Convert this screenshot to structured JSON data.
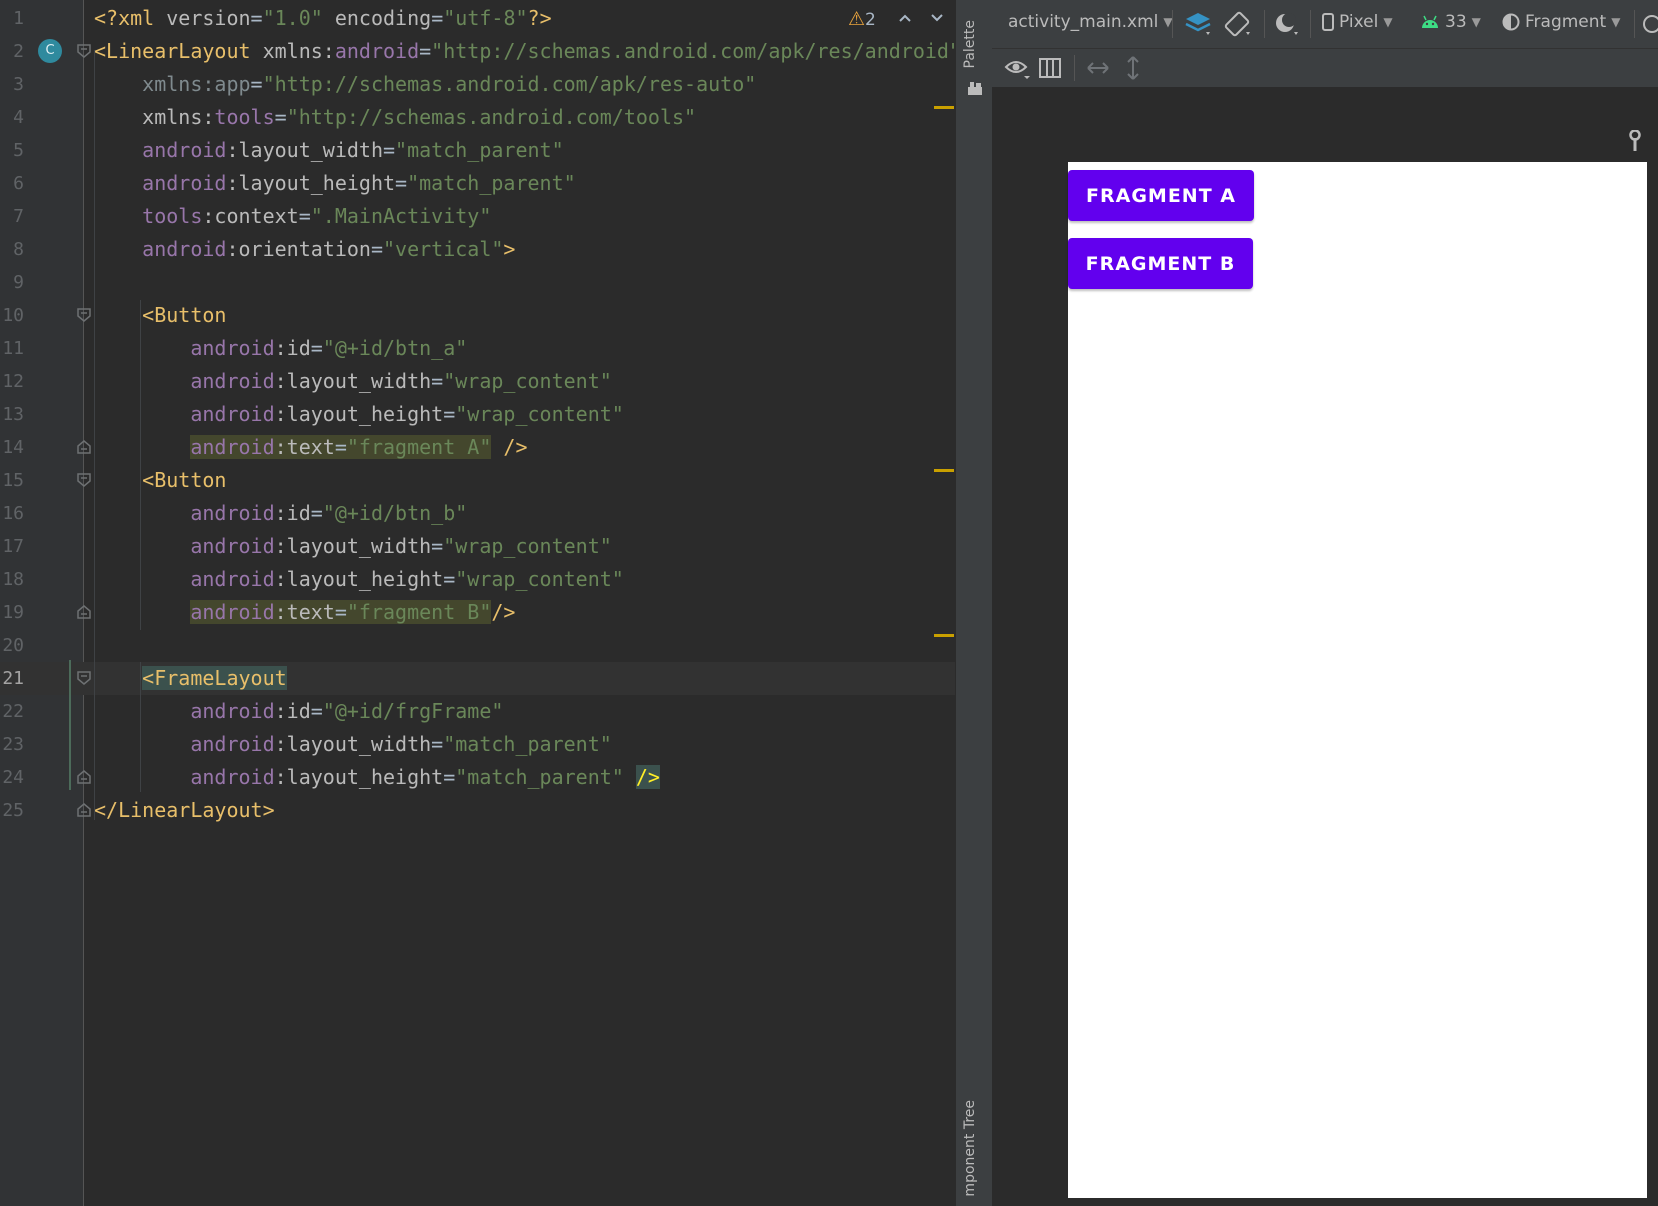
{
  "editor": {
    "warning_count": "2",
    "lines": [
      {
        "n": "1",
        "segs": [
          [
            "tag",
            "<?xml "
          ],
          [
            "attr",
            "version"
          ],
          [
            "eq",
            "="
          ],
          [
            "val",
            "\"1.0\""
          ],
          [
            "attr",
            " encoding"
          ],
          [
            "eq",
            "="
          ],
          [
            "val",
            "\"utf-8\""
          ],
          [
            "tag",
            "?>"
          ]
        ]
      },
      {
        "n": "2",
        "segs": [
          [
            "tag",
            "<LinearLayout "
          ],
          [
            "attr",
            "xmlns:"
          ],
          [
            "ns",
            "android"
          ],
          [
            "eq",
            "="
          ],
          [
            "val",
            "\"http://schemas.android.com/apk/res/android\""
          ]
        ]
      },
      {
        "n": "3",
        "segs": [
          [
            "dim",
            "    xmlns:app"
          ],
          [
            "eq",
            "="
          ],
          [
            "val",
            "\"http://schemas.android.com/apk/res-auto\""
          ]
        ]
      },
      {
        "n": "4",
        "segs": [
          [
            "attr",
            "    xmlns:"
          ],
          [
            "ns",
            "tools"
          ],
          [
            "eq",
            "="
          ],
          [
            "val",
            "\"http://schemas.android.com/tools\""
          ]
        ]
      },
      {
        "n": "5",
        "segs": [
          [
            "ns",
            "    android"
          ],
          [
            "attr",
            ":layout_width"
          ],
          [
            "eq",
            "="
          ],
          [
            "val",
            "\"match_parent\""
          ]
        ]
      },
      {
        "n": "6",
        "segs": [
          [
            "ns",
            "    android"
          ],
          [
            "attr",
            ":layout_height"
          ],
          [
            "eq",
            "="
          ],
          [
            "val",
            "\"match_parent\""
          ]
        ]
      },
      {
        "n": "7",
        "segs": [
          [
            "ns",
            "    tools"
          ],
          [
            "attr",
            ":context"
          ],
          [
            "eq",
            "="
          ],
          [
            "val",
            "\".MainActivity\""
          ]
        ]
      },
      {
        "n": "8",
        "segs": [
          [
            "ns",
            "    android"
          ],
          [
            "attr",
            ":orientation"
          ],
          [
            "eq",
            "="
          ],
          [
            "val",
            "\"vertical\""
          ],
          [
            "tag",
            ">"
          ]
        ]
      },
      {
        "n": "9",
        "segs": []
      },
      {
        "n": "10",
        "segs": [
          [
            "tag",
            "    <Button"
          ]
        ]
      },
      {
        "n": "11",
        "segs": [
          [
            "ns",
            "        android"
          ],
          [
            "attr",
            ":id"
          ],
          [
            "eq",
            "="
          ],
          [
            "val",
            "\"@+id/btn_a\""
          ]
        ]
      },
      {
        "n": "12",
        "segs": [
          [
            "ns",
            "        android"
          ],
          [
            "attr",
            ":layout_width"
          ],
          [
            "eq",
            "="
          ],
          [
            "val",
            "\"wrap_content\""
          ]
        ]
      },
      {
        "n": "13",
        "segs": [
          [
            "ns",
            "        android"
          ],
          [
            "attr",
            ":layout_height"
          ],
          [
            "eq",
            "="
          ],
          [
            "val",
            "\"wrap_content\""
          ]
        ]
      },
      {
        "n": "14",
        "segs": [
          [
            "attr",
            "        "
          ],
          [
            "nshl",
            "android"
          ],
          [
            "attrhl",
            ":text"
          ],
          [
            "eqhl",
            "="
          ],
          [
            "valhl",
            "\"fragment A\""
          ],
          [
            "tag",
            " />"
          ]
        ]
      },
      {
        "n": "15",
        "segs": [
          [
            "tag",
            "    <Button"
          ]
        ]
      },
      {
        "n": "16",
        "segs": [
          [
            "ns",
            "        android"
          ],
          [
            "attr",
            ":id"
          ],
          [
            "eq",
            "="
          ],
          [
            "val",
            "\"@+id/btn_b\""
          ]
        ]
      },
      {
        "n": "17",
        "segs": [
          [
            "ns",
            "        android"
          ],
          [
            "attr",
            ":layout_width"
          ],
          [
            "eq",
            "="
          ],
          [
            "val",
            "\"wrap_content\""
          ]
        ]
      },
      {
        "n": "18",
        "segs": [
          [
            "ns",
            "        android"
          ],
          [
            "attr",
            ":layout_height"
          ],
          [
            "eq",
            "="
          ],
          [
            "val",
            "\"wrap_content\""
          ]
        ]
      },
      {
        "n": "19",
        "segs": [
          [
            "attr",
            "        "
          ],
          [
            "nshl",
            "android"
          ],
          [
            "attrhl",
            ":text"
          ],
          [
            "eqhl",
            "="
          ],
          [
            "valhl",
            "\"fragment B\""
          ],
          [
            "tag",
            "/>"
          ]
        ]
      },
      {
        "n": "20",
        "segs": []
      },
      {
        "n": "21",
        "segs": [
          [
            "attr",
            "    "
          ],
          [
            "taghlcur",
            "<FrameLayout"
          ]
        ]
      },
      {
        "n": "22",
        "segs": [
          [
            "ns",
            "        android"
          ],
          [
            "attr",
            ":id"
          ],
          [
            "eq",
            "="
          ],
          [
            "val",
            "\"@+id/frgFrame\""
          ]
        ]
      },
      {
        "n": "23",
        "segs": [
          [
            "ns",
            "        android"
          ],
          [
            "attr",
            ":layout_width"
          ],
          [
            "eq",
            "="
          ],
          [
            "val",
            "\"match_parent\""
          ]
        ]
      },
      {
        "n": "24",
        "segs": [
          [
            "ns",
            "        android"
          ],
          [
            "attr",
            ":layout_height"
          ],
          [
            "eq",
            "="
          ],
          [
            "val",
            "\"match_parent\""
          ],
          [
            "attr",
            " "
          ],
          [
            "tagend",
            "/>"
          ]
        ]
      },
      {
        "n": "25",
        "segs": [
          [
            "tag",
            "</LinearLayout>"
          ]
        ]
      }
    ]
  },
  "side_strip": {
    "palette_label": "Palette",
    "component_tree_label": "mponent Tree"
  },
  "design_toolbar": {
    "file_name": "activity_main.xml",
    "device": "Pixel",
    "api_level": "33",
    "theme": "Fragment"
  },
  "preview": {
    "button_a": "FRAGMENT A",
    "button_b": "FRAGMENT B"
  },
  "colors": {
    "button_bg": "#6200ee",
    "editor_bg": "#2b2b2b"
  }
}
